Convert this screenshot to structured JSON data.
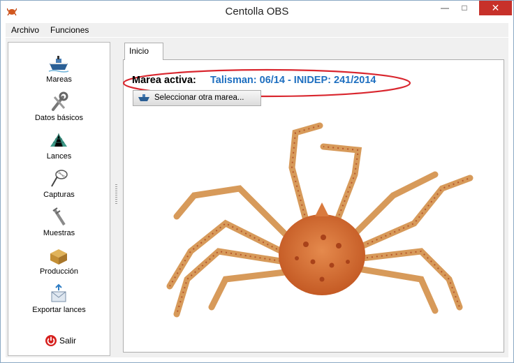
{
  "window": {
    "title": "Centolla OBS",
    "minimize": "—",
    "maximize": "□",
    "close": "✕"
  },
  "menu": [
    "Archivo",
    "Funciones"
  ],
  "sidebar": {
    "items": [
      {
        "label": "Mareas",
        "icon": "ship-icon"
      },
      {
        "label": "Datos básicos",
        "icon": "wrench-icon"
      },
      {
        "label": "Lances",
        "icon": "net-icon"
      },
      {
        "label": "Capturas",
        "icon": "landing-net-icon"
      },
      {
        "label": "Muestras",
        "icon": "caliper-icon"
      },
      {
        "label": "Producción",
        "icon": "box-icon"
      },
      {
        "label": "Exportar lances",
        "icon": "export-mail-icon"
      }
    ],
    "exit_label": "Salir"
  },
  "tabs": [
    {
      "label": "Inicio",
      "active": true
    }
  ],
  "home": {
    "active_label": "Marea activa:",
    "active_value": "Talisman: 06/14 - INIDEP: 241/2014",
    "select_button": "Seleccionar otra marea..."
  },
  "colors": {
    "accent": "#1e6fc0",
    "highlight_ring": "#d9262e",
    "close_button": "#c7312a"
  }
}
